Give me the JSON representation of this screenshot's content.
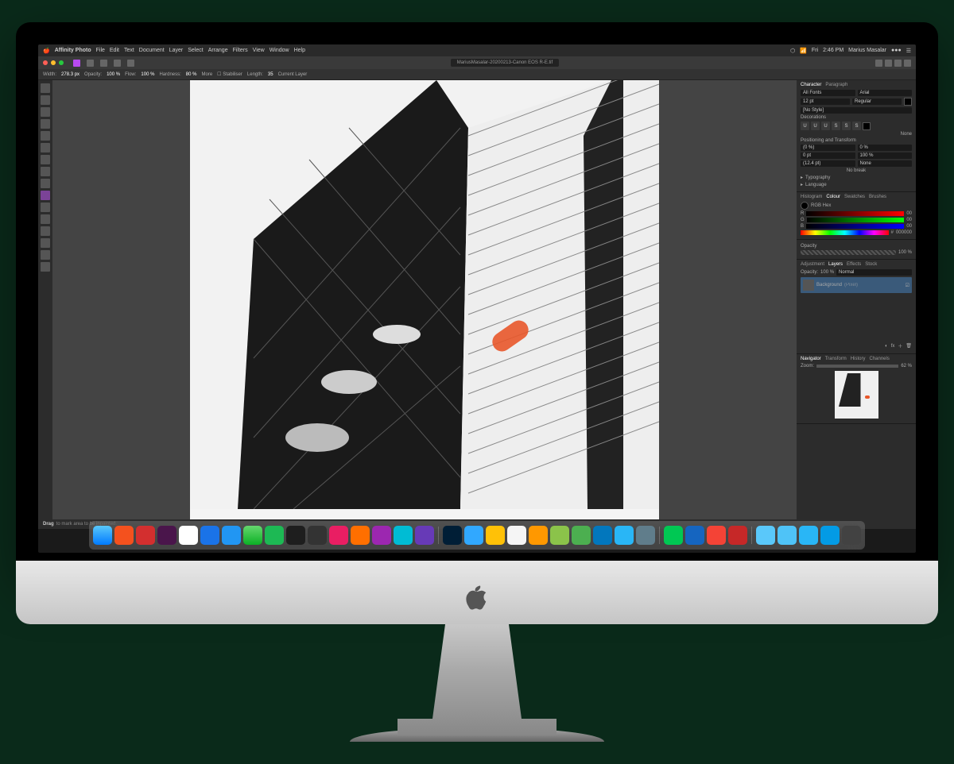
{
  "menubar": {
    "app": "Affinity Photo",
    "items": [
      "File",
      "Edit",
      "Text",
      "Document",
      "Layer",
      "Select",
      "Arrange",
      "Filters",
      "View",
      "Window",
      "Help"
    ],
    "right": {
      "day": "Fri",
      "time": "2:46 PM",
      "user": "Marius Masalar"
    }
  },
  "window": {
    "title": "MariusMasalar-20200213-Canon EOS R-E.tif"
  },
  "toolbar": {
    "width_label": "Width:",
    "width": "278.3 px",
    "opacity_label": "Opacity:",
    "opacity": "100 %",
    "flow_label": "Flow:",
    "flow": "100 %",
    "hardness_label": "Hardness:",
    "hardness": "80 %",
    "more": "More",
    "stabiliser": "Stabiliser",
    "length_label": "Length:",
    "length": "35",
    "current_layer": "Current Layer"
  },
  "status": {
    "action": "Drag",
    "hint": "to mark area to be inpainted."
  },
  "panels": {
    "character": {
      "tabs": [
        "Character",
        "Paragraph"
      ],
      "font_collection": "All Fonts",
      "font": "Arial",
      "size": "12 pt",
      "weight": "Regular",
      "style": "[No Style]",
      "decorations_label": "Decorations",
      "decorations": [
        "U",
        "U",
        "U",
        "S",
        "S",
        "S"
      ],
      "none": "None",
      "pos_label": "Positioning and Transform",
      "pos_vals": [
        "(0 %)",
        "0 %",
        "0 pt",
        "100 %",
        "(12.4 pt)",
        "None"
      ],
      "nobreak": "No break",
      "typography": "Typography",
      "language": "Language"
    },
    "colour": {
      "tabs": [
        "Histogram",
        "Colour",
        "Swatches",
        "Brushes"
      ],
      "mode": "RGB Hex",
      "r": "00",
      "g": "00",
      "b": "00",
      "hex": "000000"
    },
    "opacity_panel": {
      "label": "Opacity",
      "value": "100 %"
    },
    "layers": {
      "tabs": [
        "Adjustment",
        "Layers",
        "Effects",
        "Stock"
      ],
      "opacity_label": "Opacity:",
      "opacity": "100 %",
      "blend": "Normal",
      "layer": "Background",
      "locked": "(Pixel)"
    },
    "navigator": {
      "tabs": [
        "Navigator",
        "Transform",
        "History",
        "Channels"
      ],
      "zoom_label": "Zoom:",
      "zoom": "62 %"
    }
  },
  "dock": {
    "count": 36
  }
}
